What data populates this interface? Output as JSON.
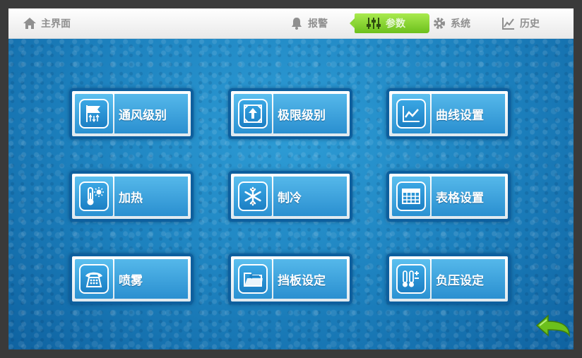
{
  "nav": {
    "home": "主界面",
    "alarm": "报警",
    "params": "参数",
    "system": "系统",
    "history": "历史"
  },
  "tiles": [
    {
      "label": "通风级别",
      "icon": "ventilation-flag-icon"
    },
    {
      "label": "极限级别",
      "icon": "limit-arrows-icon"
    },
    {
      "label": "曲线设置",
      "icon": "curve-chart-icon"
    },
    {
      "label": "加热",
      "icon": "thermometer-sun-icon"
    },
    {
      "label": "制冷",
      "icon": "snowflake-icon"
    },
    {
      "label": "表格设置",
      "icon": "table-grid-icon"
    },
    {
      "label": "喷雾",
      "icon": "spray-phone-icon"
    },
    {
      "label": "挡板设定",
      "icon": "baffle-folder-icon"
    },
    {
      "label": "负压设定",
      "icon": "thermometers-plus-minus-icon"
    }
  ],
  "colors": {
    "active_nav": "#7cc828",
    "tile_blue": "#2a8fd0",
    "background": "#1d86c2"
  }
}
